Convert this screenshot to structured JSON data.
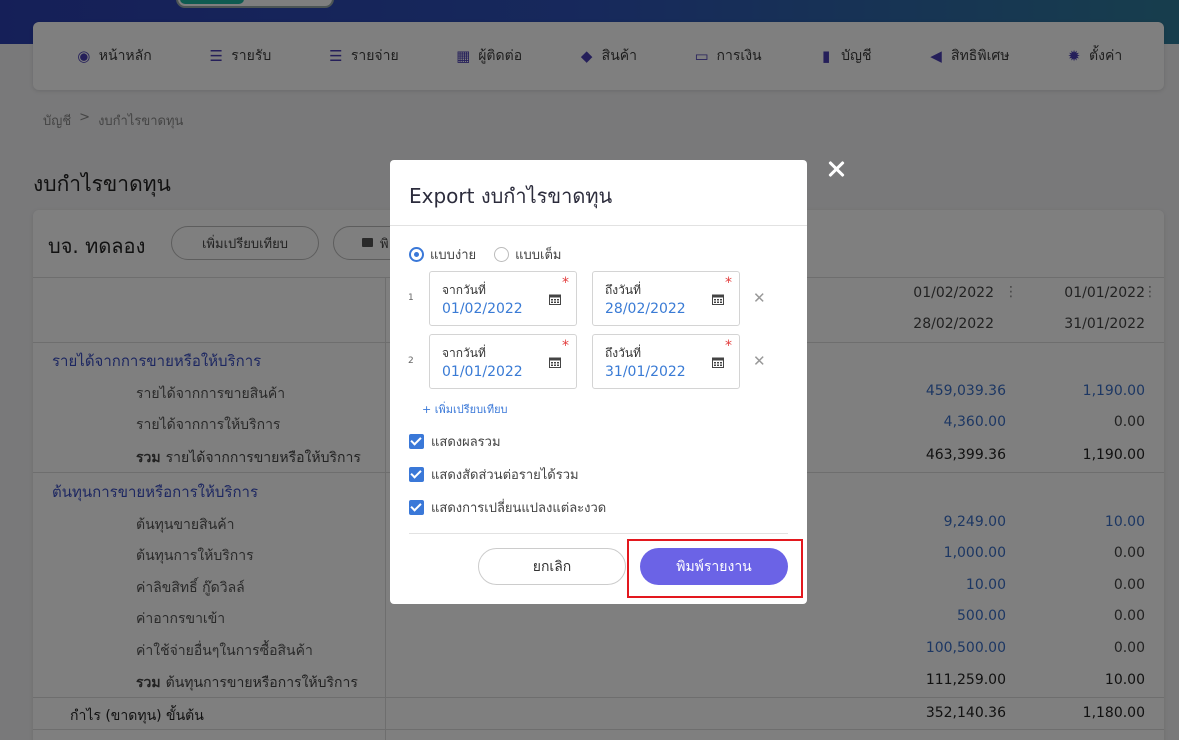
{
  "nav": {
    "items": [
      {
        "icon": "dashboard-icon",
        "glyph": "◉",
        "label": "หน้าหลัก"
      },
      {
        "icon": "income-icon",
        "glyph": "☰",
        "label": "รายรับ"
      },
      {
        "icon": "expense-icon",
        "glyph": "☰",
        "label": "รายจ่าย"
      },
      {
        "icon": "contacts-icon",
        "glyph": "▦",
        "label": "ผู้ติดต่อ"
      },
      {
        "icon": "product-box-icon",
        "glyph": "◆",
        "label": "สินค้า"
      },
      {
        "icon": "money-icon",
        "glyph": "▭",
        "label": "การเงิน"
      },
      {
        "icon": "ledger-book-icon",
        "glyph": "▮",
        "label": "บัญชี"
      },
      {
        "icon": "megaphone-icon",
        "glyph": "◀",
        "label": "สิทธิพิเศษ"
      },
      {
        "icon": "gear-icon",
        "glyph": "✹",
        "label": "ตั้งค่า"
      }
    ]
  },
  "breadcrumb": {
    "parent": "บัญชี",
    "separator": ">",
    "current": "งบกำไรขาดทุน"
  },
  "page": {
    "title": "งบกำไรขาดทุน"
  },
  "report": {
    "company": "บจ. ทดลอง",
    "compare_button": "เพิ่มเปรียบเทียบ",
    "print_button_partial": "พิ",
    "col1": {
      "from": "01/02/2022",
      "to": "28/02/2022"
    },
    "col2": {
      "from": "01/01/2022",
      "to": "31/01/2022"
    },
    "rows": {
      "revenue_section": "รายได้จากการขายหรือให้บริการ",
      "sales_revenue": {
        "label": "รายได้จากการขายสินค้า",
        "v1": "459,039.36",
        "v2": "1,190.00"
      },
      "service_revenue": {
        "label": "รายได้จากการให้บริการ",
        "v1": "4,360.00",
        "v2": "0.00"
      },
      "revenue_total": {
        "prefix": "รวม",
        "label": "รายได้จากการขายหรือให้บริการ",
        "v1": "463,399.36",
        "v2": "1,190.00"
      },
      "cost_section": "ต้นทุนการขายหรือการให้บริการ",
      "cost_goods": {
        "label": "ต้นทุนขายสินค้า",
        "v1": "9,249.00",
        "v2": "10.00"
      },
      "cost_service": {
        "label": "ต้นทุนการให้บริการ",
        "v1": "1,000.00",
        "v2": "0.00"
      },
      "royalty": {
        "label": "ค่าลิขสิทธิ์ กู๊ดวิลล์",
        "v1": "10.00",
        "v2": "0.00"
      },
      "import_duty": {
        "label": "ค่าอากรขาเข้า",
        "v1": "500.00",
        "v2": "0.00"
      },
      "other_purchase": {
        "label": "ค่าใช้จ่ายอื่นๆในการซื้อสินค้า",
        "v1": "100,500.00",
        "v2": "0.00"
      },
      "cost_total": {
        "prefix": "รวม",
        "label": "ต้นทุนการขายหรือการให้บริการ",
        "v1": "111,259.00",
        "v2": "10.00"
      },
      "gross_profit": {
        "label": "กำไร (ขาดทุน) ขั้นต้น",
        "v1": "352,140.36",
        "v2": "1,180.00"
      }
    }
  },
  "modal": {
    "title": "Export งบกำไรขาดทุน",
    "mode_simple": "แบบง่าย",
    "mode_full": "แบบเต็ม",
    "ranges": [
      {
        "index": "1",
        "from_label": "จากวันที่",
        "from": "01/02/2022",
        "to_label": "ถึงวันที่",
        "to": "28/02/2022"
      },
      {
        "index": "2",
        "from_label": "จากวันที่",
        "from": "01/01/2022",
        "to_label": "ถึงวันที่",
        "to": "31/01/2022"
      }
    ],
    "required_mark": "*",
    "remove_glyph": "✕",
    "add_compare": "+ เพิ่มเปรียบเทียบ",
    "options": [
      {
        "label": "แสดงผลรวม",
        "checked": true
      },
      {
        "label": "แสดงสัดส่วนต่อรายได้รวม",
        "checked": true
      },
      {
        "label": "แสดงการเปลี่ยนแปลงแต่ละงวด",
        "checked": true
      }
    ],
    "cancel": "ยกเลิก",
    "print": "พิมพ์รายงาน"
  }
}
